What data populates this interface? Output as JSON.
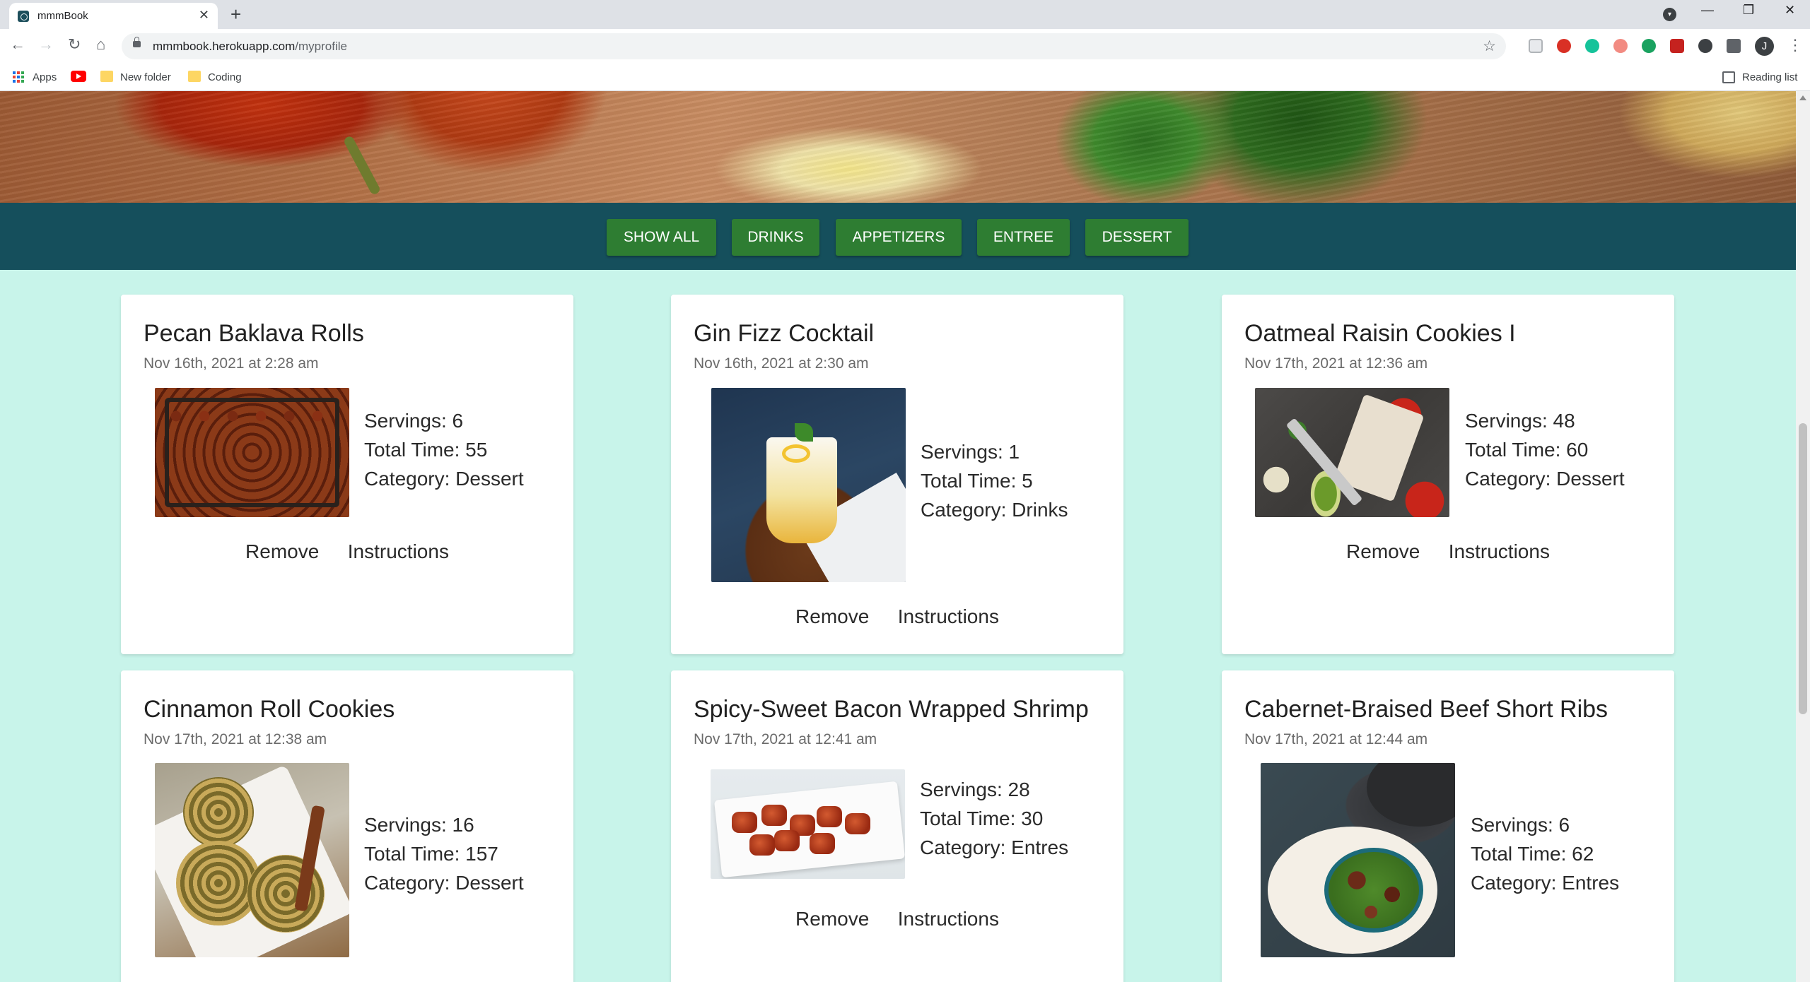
{
  "browser": {
    "tab_title": "mmmBook",
    "tab_close": "✕",
    "new_tab": "+",
    "url_host": "mmmbook.herokuapp.com",
    "url_path": "/myprofile",
    "win_min": "—",
    "win_restore": "❐",
    "win_close": "✕",
    "nav_back": "←",
    "nav_forward": "→",
    "nav_reload": "↻",
    "nav_home": "⌂",
    "star": "☆",
    "menu": "⋮",
    "avatar_letter": "J",
    "bookmarks": {
      "apps": "Apps",
      "new_folder": "New folder",
      "coding": "Coding",
      "reading_list": "Reading list"
    }
  },
  "filters": [
    "SHOW ALL",
    "DRINKS",
    "APPETIZERS",
    "ENTREE",
    "DESSERT"
  ],
  "actions": {
    "remove": "Remove",
    "instructions": "Instructions"
  },
  "recipes": [
    {
      "title": "Pecan Baklava Rolls",
      "date": "Nov 16th, 2021 at 2:28 am",
      "servings": "Servings: 6",
      "time": "Total Time: 55",
      "category": "Category: Dessert"
    },
    {
      "title": "Gin Fizz Cocktail",
      "date": "Nov 16th, 2021 at 2:30 am",
      "servings": "Servings: 1",
      "time": "Total Time: 5",
      "category": "Category: Drinks"
    },
    {
      "title": "Oatmeal Raisin Cookies I",
      "date": "Nov 17th, 2021 at 12:36 am",
      "servings": "Servings: 48",
      "time": "Total Time: 60",
      "category": "Category: Dessert"
    },
    {
      "title": "Cinnamon Roll Cookies",
      "date": "Nov 17th, 2021 at 12:38 am",
      "servings": "Servings: 16",
      "time": "Total Time: 157",
      "category": "Category: Dessert"
    },
    {
      "title": "Spicy-Sweet Bacon Wrapped Shrimp",
      "date": "Nov 17th, 2021 at 12:41 am",
      "servings": "Servings: 28",
      "time": "Total Time: 30",
      "category": "Category: Entres"
    },
    {
      "title": "Cabernet-Braised Beef Short Ribs",
      "date": "Nov 17th, 2021 at 12:44 am",
      "servings": "Servings: 6",
      "time": "Total Time: 62",
      "category": "Category: Entres"
    }
  ]
}
